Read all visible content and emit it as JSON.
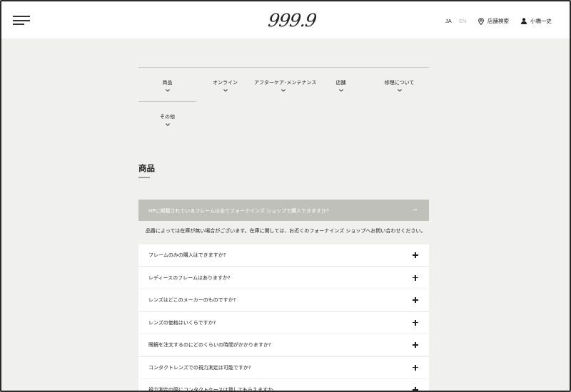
{
  "header": {
    "logo": "999.9",
    "lang_ja": "JA",
    "lang_en": "EN",
    "store_search": "店舗検索",
    "user_name": "小橋一史",
    "icons": {
      "menu": "hamburger-icon",
      "store": "location-pin-icon",
      "user": "user-icon"
    }
  },
  "tabs": [
    {
      "label": "商品"
    },
    {
      "label": "オンライン"
    },
    {
      "label": "アフターケア･メンテナンス"
    },
    {
      "label": "店舗"
    },
    {
      "label": "修理について"
    },
    {
      "label": "その他"
    }
  ],
  "section": {
    "title": "商品"
  },
  "faq_open": {
    "question": "HPに掲載されているフレームは全てフォーナインズ ショップで購入できますか?",
    "answer": "品番によっては在庫が無い場合がございます。在庫に関しては、お近くのフォーナインズ ショップへお問い合わせください。"
  },
  "faq_items": [
    {
      "question": "フレームのみの購入はできますか?"
    },
    {
      "question": "レディースのフレームはありますか?"
    },
    {
      "question": "レンズはどこのメーカーのものですか?"
    },
    {
      "question": "レンズの価格はいくらですか?"
    },
    {
      "question": "眼鏡を注文するのにどのくらいの時間がかかりますか?"
    },
    {
      "question": "コンタクトレンズでの視力測定は可能ですか?"
    },
    {
      "question": "視力測定の際にコンタクトケースは貸してもらえますか。"
    }
  ],
  "colors": {
    "open_bg": "#c0c0ba",
    "page_bg": "#f0f0ee",
    "text": "#222222"
  }
}
